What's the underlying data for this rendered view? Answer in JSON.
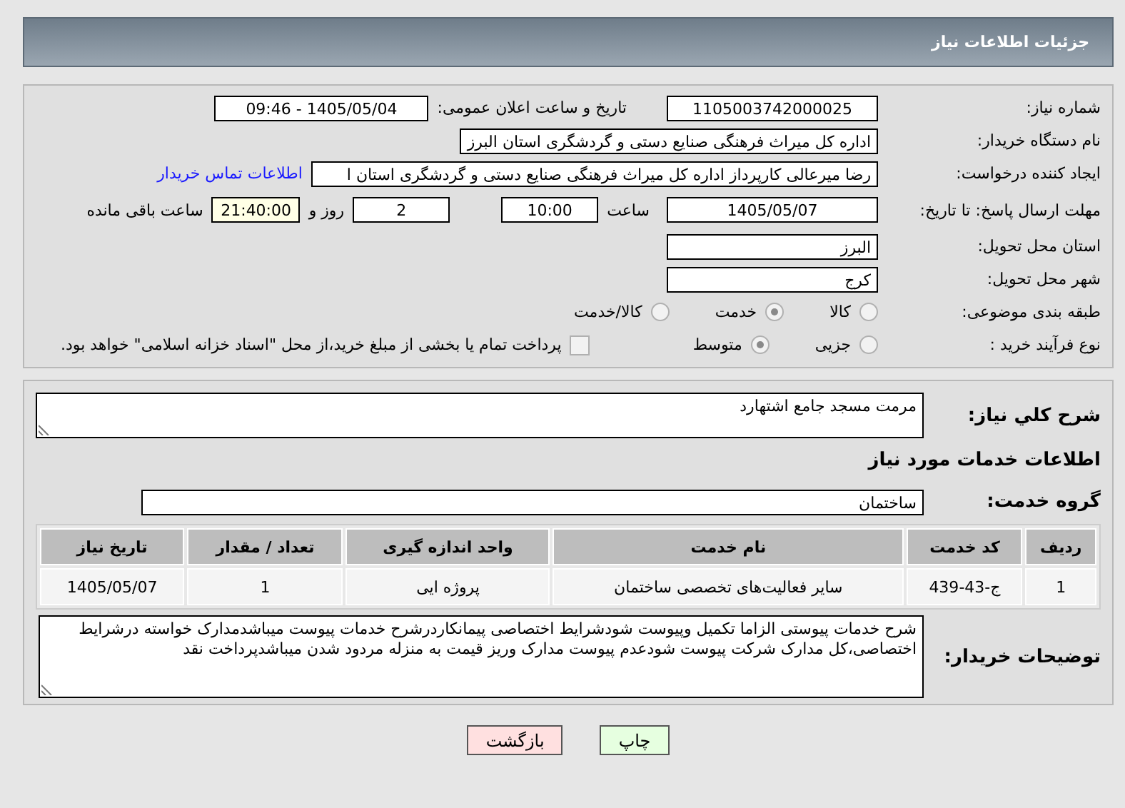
{
  "header": {
    "title": "جزئیات اطلاعات نیاز"
  },
  "need_number": {
    "label": "شماره نیاز:",
    "value": "1105003742000025"
  },
  "announce": {
    "label": "تاریخ و ساعت اعلان عمومی:",
    "value": "1405/05/04 - 09:46"
  },
  "buyer_org": {
    "label": "نام دستگاه خریدار:",
    "value": "اداره کل میراث فرهنگی  صنایع دستی و گردشگری استان البرز"
  },
  "requester": {
    "label": "ایجاد کننده درخواست:",
    "value": "رضا میرعالی کارپرداز اداره کل میراث فرهنگی  صنایع دستی و گردشگری استان ا",
    "link": "اطلاعات تماس خریدار"
  },
  "deadline": {
    "label": "مهلت ارسال پاسخ: تا تاریخ:",
    "date": "1405/05/07",
    "time_label": "ساعت",
    "time": "10:00",
    "days": "2",
    "days_label": "روز و",
    "remaining": "21:40:00",
    "remaining_label": "ساعت باقی مانده"
  },
  "province": {
    "label": "استان محل تحویل:",
    "value": "البرز"
  },
  "city": {
    "label": "شهر محل تحویل:",
    "value": "کرج"
  },
  "category": {
    "label": "طبقه بندی موضوعی:",
    "options": [
      {
        "label": "کالا",
        "selected": false
      },
      {
        "label": "خدمت",
        "selected": true
      },
      {
        "label": "کالا/خدمت",
        "selected": false
      }
    ]
  },
  "process": {
    "label": "نوع فرآیند خرید :",
    "options": [
      {
        "label": "جزیی",
        "selected": false
      },
      {
        "label": "متوسط",
        "selected": true
      }
    ],
    "payment": {
      "checked": false,
      "text": "پرداخت تمام یا بخشی از مبلغ خرید،از محل \"اسناد خزانه اسلامی\" خواهد بود."
    }
  },
  "summary": {
    "label": "شرح کلي نياز:",
    "value": "مرمت مسجد جامع اشتهارد"
  },
  "services_title": "اطلاعات خدمات مورد نیاز",
  "service_group": {
    "label": "گروه خدمت:",
    "value": "ساختمان"
  },
  "table": {
    "columns": [
      "ردیف",
      "کد خدمت",
      "نام خدمت",
      "واحد اندازه گیری",
      "تعداد / مقدار",
      "تاریخ نیاز"
    ],
    "rows": [
      [
        "1",
        "ج-43-439",
        "سایر فعالیت‌های تخصصی ساختمان",
        "پروژه ایی",
        "1",
        "1405/05/07"
      ]
    ]
  },
  "buyer_notes": {
    "label": "توضیحات خریدار:",
    "value": "شرح خدمات پیوستی الزاما تکمیل وپیوست شودشرایط اختصاصی پیمانکاردرشرح خدمات پیوست میباشدمدارک خواسته درشرایط اختصاصی،کل مدارک شرکت پیوست شودعدم پیوست مدارک وریز قیمت به منزله مردود شدن میباشدپرداخت نقد"
  },
  "buttons": [
    {
      "label": "چاپ",
      "kind": "print"
    },
    {
      "label": "بازگشت",
      "kind": "back"
    }
  ]
}
